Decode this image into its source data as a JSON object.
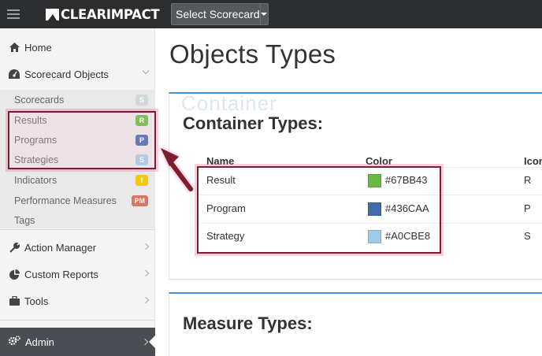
{
  "topbar": {
    "logo_text": "CLEARIMPACT",
    "scorecard_select": "Select Scorecard"
  },
  "sidebar": {
    "items": [
      {
        "label": "Home",
        "icon": "home-icon"
      },
      {
        "label": "Scorecard Objects",
        "icon": "dashboard-icon"
      },
      {
        "label": "Action Manager",
        "icon": "wrench-icon"
      },
      {
        "label": "Custom Reports",
        "icon": "pie-chart-icon"
      },
      {
        "label": "Tools",
        "icon": "briefcase-icon"
      },
      {
        "label": "Admin",
        "icon": "gears-icon"
      }
    ],
    "sub_items": [
      {
        "label": "Scorecards",
        "badge": "S",
        "badge_color": "#cfd8dc"
      },
      {
        "label": "Results",
        "badge": "R",
        "badge_color": "#67BB43"
      },
      {
        "label": "Programs",
        "badge": "P",
        "badge_color": "#436CAA"
      },
      {
        "label": "Strategies",
        "badge": "S",
        "badge_color": "#A0CBE8"
      },
      {
        "label": "Indicators",
        "badge": "I",
        "badge_color": "#f2c811"
      },
      {
        "label": "Performance Measures",
        "badge": "PM",
        "badge_color": "#d9765f"
      },
      {
        "label": "Tags",
        "badge": "",
        "badge_color": ""
      }
    ]
  },
  "main": {
    "title": "Objects Types",
    "container_panel": {
      "title": "Container Types:",
      "ghost_text": "Container",
      "headers": [
        "Name",
        "Color",
        "Icon"
      ],
      "rows": [
        {
          "name": "Result",
          "color": "#67BB43",
          "icon": "R"
        },
        {
          "name": "Program",
          "color": "#436CAA",
          "icon": "P"
        },
        {
          "name": "Strategy",
          "color": "#A0CBE8",
          "icon": "S"
        }
      ]
    },
    "measure_panel": {
      "title": "Measure Types:"
    }
  },
  "colors": {
    "topbar_bg": "#2b2d2f",
    "highlight_border": "#7a1f2b",
    "panel_accent": "#4a90d9"
  }
}
